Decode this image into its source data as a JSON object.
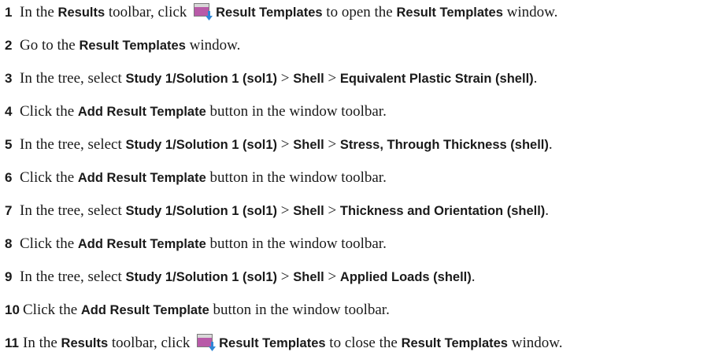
{
  "steps": [
    {
      "num": "1",
      "parts": [
        {
          "t": "In the "
        },
        {
          "t": "Results",
          "b": true
        },
        {
          "t": " toolbar, click "
        },
        {
          "icon": "result-templates-icon"
        },
        {
          "t": "Result Templates",
          "b": true
        },
        {
          "t": " to open the "
        },
        {
          "t": "Result Templates",
          "b": true
        },
        {
          "t": " window."
        }
      ]
    },
    {
      "num": "2",
      "parts": [
        {
          "t": "Go to the "
        },
        {
          "t": "Result Templates",
          "b": true
        },
        {
          "t": " window."
        }
      ]
    },
    {
      "num": "3",
      "parts": [
        {
          "t": "In the tree, select "
        },
        {
          "t": "Study 1/Solution 1 (sol1)",
          "b": true
        },
        {
          "t": " > "
        },
        {
          "t": "Shell",
          "b": true
        },
        {
          "t": " > "
        },
        {
          "t": "Equivalent Plastic Strain (shell)",
          "b": true
        },
        {
          "t": "."
        }
      ]
    },
    {
      "num": "4",
      "parts": [
        {
          "t": "Click the "
        },
        {
          "t": "Add Result Template",
          "b": true
        },
        {
          "t": " button in the window toolbar."
        }
      ]
    },
    {
      "num": "5",
      "parts": [
        {
          "t": "In the tree, select "
        },
        {
          "t": "Study 1/Solution 1 (sol1)",
          "b": true
        },
        {
          "t": " > "
        },
        {
          "t": "Shell",
          "b": true
        },
        {
          "t": " > "
        },
        {
          "t": "Stress, Through Thickness (shell)",
          "b": true
        },
        {
          "t": "."
        }
      ]
    },
    {
      "num": "6",
      "parts": [
        {
          "t": "Click the "
        },
        {
          "t": "Add Result Template",
          "b": true
        },
        {
          "t": " button in the window toolbar."
        }
      ]
    },
    {
      "num": "7",
      "parts": [
        {
          "t": "In the tree, select "
        },
        {
          "t": "Study 1/Solution 1 (sol1)",
          "b": true
        },
        {
          "t": " > "
        },
        {
          "t": "Shell",
          "b": true
        },
        {
          "t": " > "
        },
        {
          "t": "Thickness and Orientation (shell)",
          "b": true
        },
        {
          "t": "."
        }
      ]
    },
    {
      "num": "8",
      "parts": [
        {
          "t": "Click the "
        },
        {
          "t": "Add Result Template",
          "b": true
        },
        {
          "t": " button in the window toolbar."
        }
      ]
    },
    {
      "num": "9",
      "parts": [
        {
          "t": "In the tree, select "
        },
        {
          "t": "Study 1/Solution 1 (sol1)",
          "b": true
        },
        {
          "t": " > "
        },
        {
          "t": "Shell",
          "b": true
        },
        {
          "t": " > "
        },
        {
          "t": "Applied Loads (shell)",
          "b": true
        },
        {
          "t": "."
        }
      ]
    },
    {
      "num": "10",
      "parts": [
        {
          "t": "Click the "
        },
        {
          "t": "Add Result Template",
          "b": true
        },
        {
          "t": " button in the window toolbar."
        }
      ]
    },
    {
      "num": "11",
      "parts": [
        {
          "t": "In the "
        },
        {
          "t": "Results",
          "b": true
        },
        {
          "t": " toolbar, click "
        },
        {
          "icon": "result-templates-icon"
        },
        {
          "t": "Result Templates",
          "b": true
        },
        {
          "t": " to close the "
        },
        {
          "t": "Result Templates",
          "b": true
        },
        {
          "t": " window."
        }
      ]
    }
  ],
  "colors": {
    "icon_fill": "#b85aa8",
    "icon_arrow": "#2e86d6"
  }
}
